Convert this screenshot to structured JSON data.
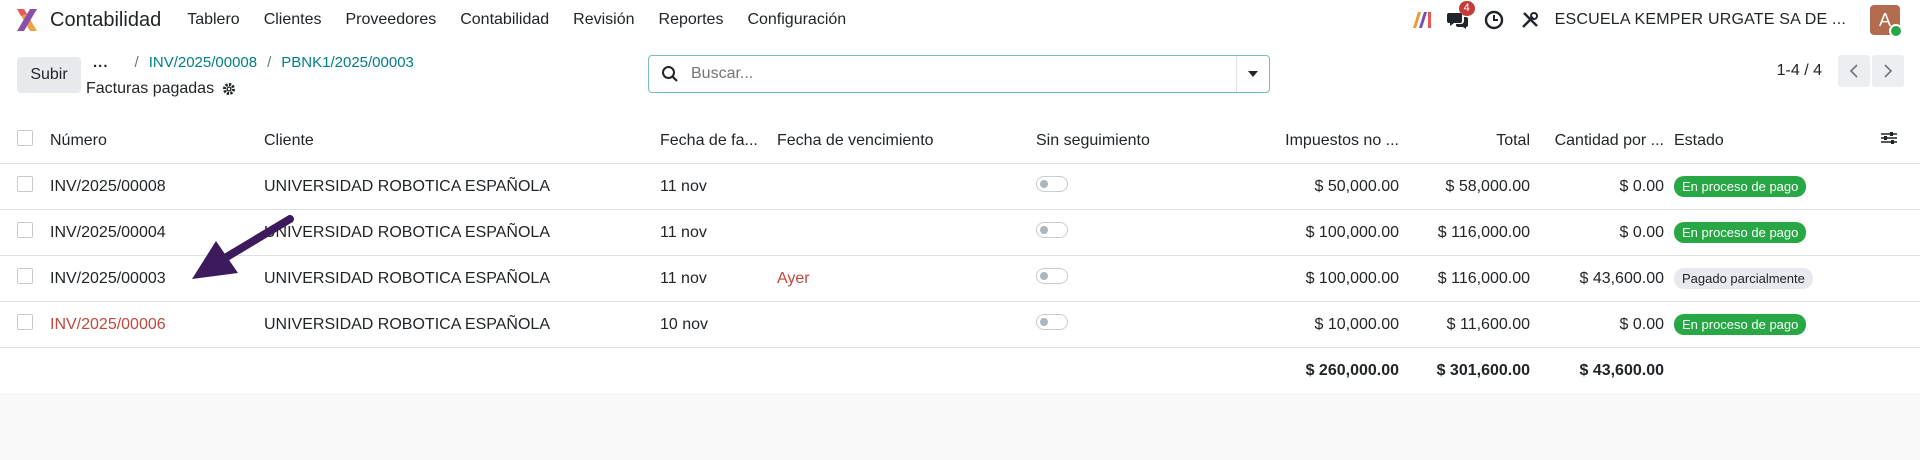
{
  "navbar": {
    "app_name": "Contabilidad",
    "menu": [
      "Tablero",
      "Clientes",
      "Proveedores",
      "Contabilidad",
      "Revisión",
      "Reportes",
      "Configuración"
    ],
    "messages_badge": "4",
    "company": "ESCUELA KEMPER URGATE SA DE ...",
    "avatar_letter": "A"
  },
  "control": {
    "upload_label": "Subir",
    "breadcrumb_dots": "...",
    "breadcrumb": [
      "INV/2025/00008",
      "PBNK1/2025/00003"
    ],
    "title": "Facturas pagadas",
    "search_placeholder": "Buscar...",
    "pager": "1-4 / 4"
  },
  "table": {
    "headers": {
      "number": "Número",
      "client": "Cliente",
      "invoice_date": "Fecha de fa...",
      "due_date": "Fecha de vencimiento",
      "no_follow": "Sin seguimiento",
      "taxes": "Impuestos no ...",
      "total": "Total",
      "amount_due": "Cantidad por ...",
      "status": "Estado"
    },
    "rows": [
      {
        "number": "INV/2025/00008",
        "client": "UNIVERSIDAD ROBOTICA ESPAÑOLA",
        "invoice_date": "11 nov",
        "due_date": "",
        "taxes": "$ 50,000.00",
        "total": "$ 58,000.00",
        "amount_due": "$ 0.00",
        "status": "En proceso de pago"
      },
      {
        "number": "INV/2025/00004",
        "client": "UNIVERSIDAD ROBOTICA ESPAÑOLA",
        "invoice_date": "11 nov",
        "due_date": "",
        "taxes": "$ 100,000.00",
        "total": "$ 116,000.00",
        "amount_due": "$ 0.00",
        "status": "En proceso de pago"
      },
      {
        "number": "INV/2025/00003",
        "client": "UNIVERSIDAD ROBOTICA ESPAÑOLA",
        "invoice_date": "11 nov",
        "due_date": "Ayer",
        "taxes": "$ 100,000.00",
        "total": "$ 116,000.00",
        "amount_due": "$ 43,600.00",
        "status": "Pagado parcialmente"
      },
      {
        "number": "INV/2025/00006",
        "client": "UNIVERSIDAD ROBOTICA ESPAÑOLA",
        "invoice_date": "10 nov",
        "due_date": "",
        "taxes": "$ 10,000.00",
        "total": "$ 11,600.00",
        "amount_due": "$ 0.00",
        "status": "En proceso de pago"
      }
    ],
    "totals": {
      "taxes": "$ 260,000.00",
      "total": "$ 301,600.00",
      "amount_due": "$ 43,600.00"
    }
  },
  "colors": {
    "accent": "#017e84",
    "status_green": "#28a745",
    "overdue_red": "#c2483b",
    "arrow": "#3d1a5c"
  }
}
